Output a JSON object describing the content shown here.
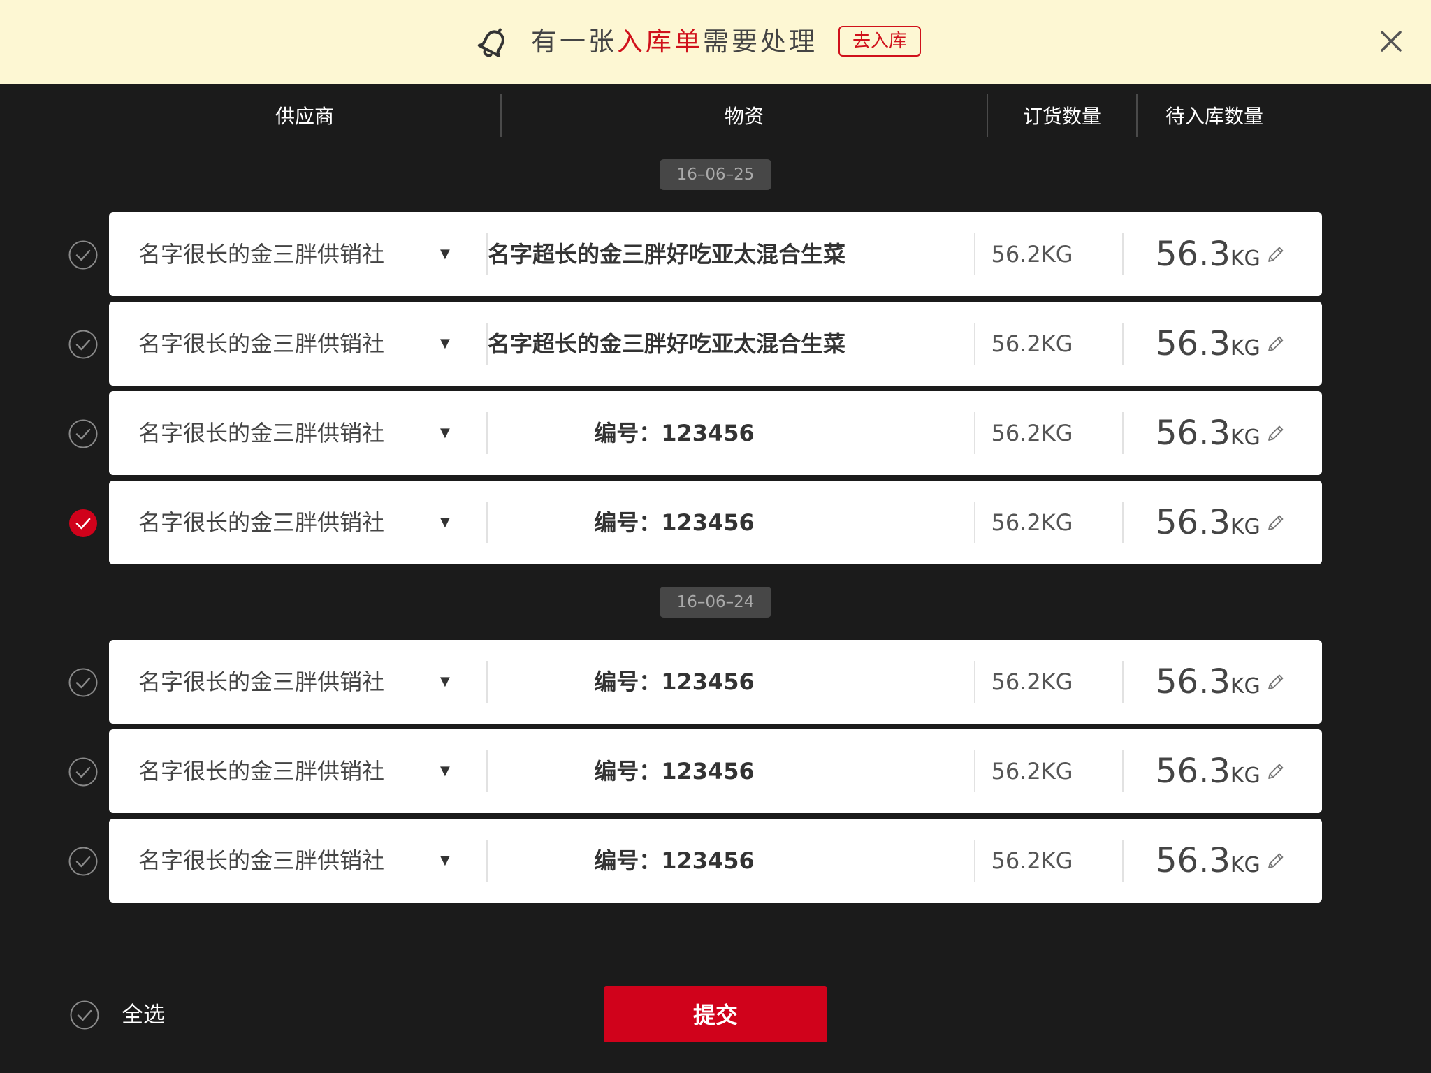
{
  "banner": {
    "message_prefix": "有一张",
    "message_highlight": "入库单",
    "message_suffix": "需要处理",
    "action_label": "去入库",
    "accent_color": "#d0111b",
    "bell_icon": "bell-icon",
    "close_icon": "close-icon"
  },
  "columns": {
    "supplier": "供应商",
    "material": "物资",
    "order_qty": "订货数量",
    "pending_qty": "待入库数量"
  },
  "groups": [
    {
      "date": "16–06–25",
      "rows": [
        {
          "checked": false,
          "supplier": "名字很长的金三胖供销社",
          "caret": "▼",
          "material": "名字超长的金三胖好吃亚太混合生菜",
          "order_qty": "56.2KG",
          "pending_value": "56.3",
          "pending_unit": "KG"
        },
        {
          "checked": false,
          "supplier": "名字很长的金三胖供销社",
          "caret": "▼",
          "material": "名字超长的金三胖好吃亚太混合生菜",
          "order_qty": "56.2KG",
          "pending_value": "56.3",
          "pending_unit": "KG"
        },
        {
          "checked": false,
          "supplier": "名字很长的金三胖供销社",
          "caret": "▼",
          "material": "编号：123456",
          "order_qty": "56.2KG",
          "pending_value": "56.3",
          "pending_unit": "KG"
        },
        {
          "checked": true,
          "supplier": "名字很长的金三胖供销社",
          "caret": "▼",
          "material": "编号：123456",
          "order_qty": "56.2KG",
          "pending_value": "56.3",
          "pending_unit": "KG"
        }
      ]
    },
    {
      "date": "16–06–24",
      "rows": [
        {
          "checked": false,
          "supplier": "名字很长的金三胖供销社",
          "caret": "▼",
          "material": "编号：123456",
          "order_qty": "56.2KG",
          "pending_value": "56.3",
          "pending_unit": "KG"
        },
        {
          "checked": false,
          "supplier": "名字很长的金三胖供销社",
          "caret": "▼",
          "material": "编号：123456",
          "order_qty": "56.2KG",
          "pending_value": "56.3",
          "pending_unit": "KG"
        },
        {
          "checked": false,
          "supplier": "名字很长的金三胖供销社",
          "caret": "▼",
          "material": "编号：123456",
          "order_qty": "56.2KG",
          "pending_value": "56.3",
          "pending_unit": "KG"
        }
      ]
    }
  ],
  "footer": {
    "select_all_label": "全选",
    "select_all_checked": false,
    "submit_label": "提交",
    "submit_color": "#d0021b"
  }
}
